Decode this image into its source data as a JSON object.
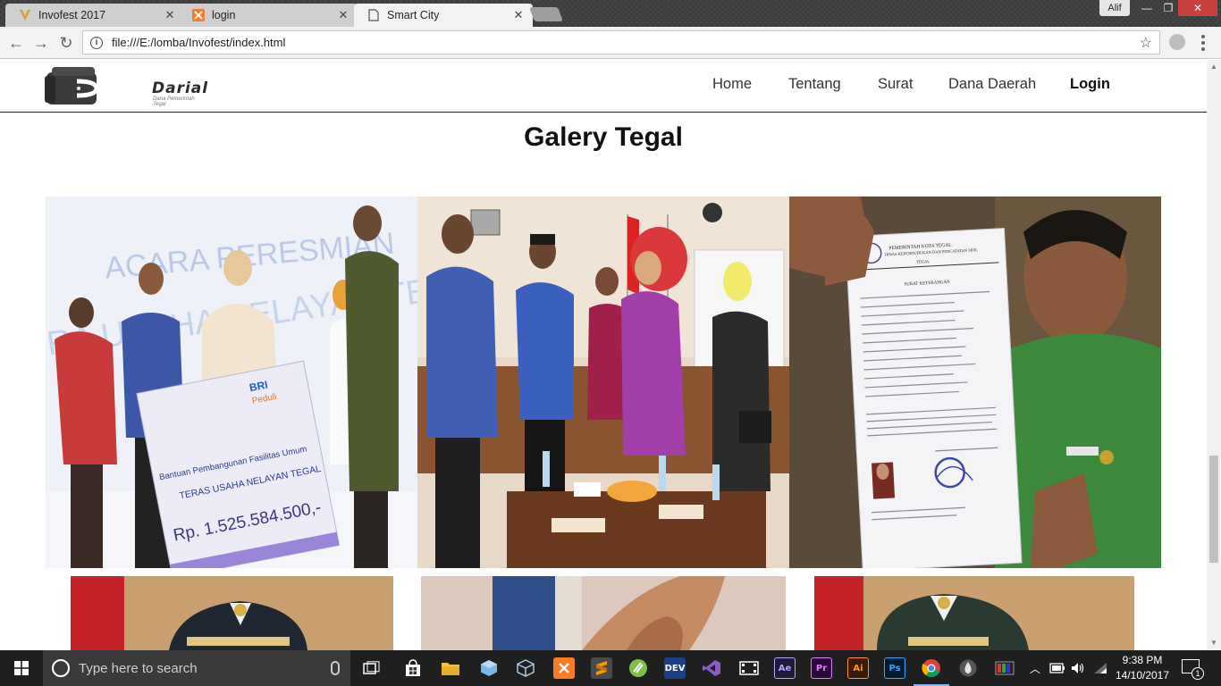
{
  "browser": {
    "tabs": [
      {
        "title": "Invofest 2017",
        "active": false
      },
      {
        "title": "login",
        "active": false
      },
      {
        "title": "Smart City",
        "active": true
      }
    ],
    "user_label": "Alif",
    "url": "file:///E:/lomba/Invofest/index.html"
  },
  "site": {
    "logo_text": "Darial",
    "logo_tagline": "Dana Pemerintah Tegal",
    "nav": [
      "Home",
      "Tentang",
      "Surat",
      "Dana Daerah",
      "Login"
    ],
    "gallery_title": "Galery Tegal"
  },
  "photos": {
    "photo1": {
      "banner_title": "ACARA PERESMIAN",
      "banner_sub": "RA USAHA NELAYAN TEGAL",
      "cheque_brand": "BRI",
      "cheque_brand2": "Peduli",
      "cheque_line1": "Bantuan Pembangunan Fasilitas Umum",
      "cheque_line2": "TERAS USAHA NELAYAN TEGAL",
      "cheque_amount": "Rp. 1.525.584.500,-"
    },
    "photo3": {
      "doc_header1": "PEMERINTAH KOTA TEGAL",
      "doc_header2": "DINAS KEPENDUDUKAN DAN PENCATATAN SIPIL",
      "doc_header3": "TEGAL",
      "doc_title": "SURAT KETERANGAN"
    }
  },
  "taskbar": {
    "search_placeholder": "Type here to search",
    "apps": [
      "task-view",
      "store",
      "file-explorer",
      "box3d",
      "box3d-outline",
      "xampp",
      "sublime",
      "android-studio",
      "devcpp",
      "visual-studio",
      "movie-maker",
      "after-effects",
      "premiere",
      "illustrator",
      "photoshop",
      "chrome",
      "droplet",
      "gamebar"
    ],
    "app_labels": {
      "devcpp": "DEV",
      "after_effects": "Ae",
      "premiere": "Pr",
      "illustrator": "Ai",
      "photoshop": "Ps"
    },
    "time": "9:38 PM",
    "date": "14/10/2017",
    "notification_count": "1"
  }
}
